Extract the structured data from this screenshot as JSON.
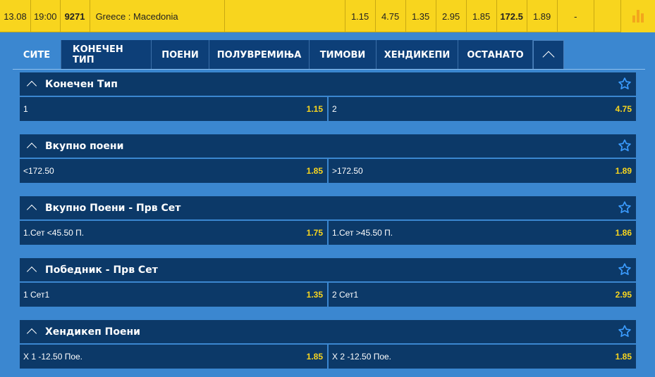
{
  "match": {
    "date": "13.08",
    "time": "19:00",
    "code": "9271",
    "name": "Greece : Macedonia",
    "odds": [
      "1.15",
      "4.75",
      "1.35",
      "2.95",
      "1.85",
      "172.5",
      "1.89",
      "-"
    ],
    "stats_icon": "bar-chart-icon"
  },
  "tabs": [
    {
      "label": "СИТЕ",
      "active": true
    },
    {
      "label": "КОНЕЧЕН ТИП"
    },
    {
      "label": "ПОЕНИ"
    },
    {
      "label": "ПОЛУВРЕМИЊА"
    },
    {
      "label": "ТИМОВИ"
    },
    {
      "label": "ХЕНДИКЕПИ"
    },
    {
      "label": "ОСТАНАТО"
    }
  ],
  "markets": [
    {
      "title": "Конечен Тип",
      "left": {
        "label": "1",
        "odd": "1.15"
      },
      "right": {
        "label": "2",
        "odd": "4.75"
      }
    },
    {
      "title": "Вкупно поени",
      "left": {
        "label": "<172.50",
        "odd": "1.85"
      },
      "right": {
        "label": ">172.50",
        "odd": "1.89"
      }
    },
    {
      "title": "Вкупно Поени - Прв Сет",
      "left": {
        "label": "1.Сет <45.50 П.",
        "odd": "1.75"
      },
      "right": {
        "label": "1.Сет >45.50 П.",
        "odd": "1.86"
      }
    },
    {
      "title": "Победник - Прв Сет",
      "left": {
        "label": "1 Сет1",
        "odd": "1.35"
      },
      "right": {
        "label": "2 Сет1",
        "odd": "2.95"
      }
    },
    {
      "title": "Хендикеп Поени",
      "left": {
        "label": "X 1 -12.50 Пое.",
        "odd": "1.85"
      },
      "right": {
        "label": "X 2 -12.50 Пое.",
        "odd": "1.85"
      }
    }
  ],
  "colors": {
    "accent_yellow": "#f8d51e",
    "panel_dark": "#0c3968",
    "background_blue": "#3b87d0"
  }
}
